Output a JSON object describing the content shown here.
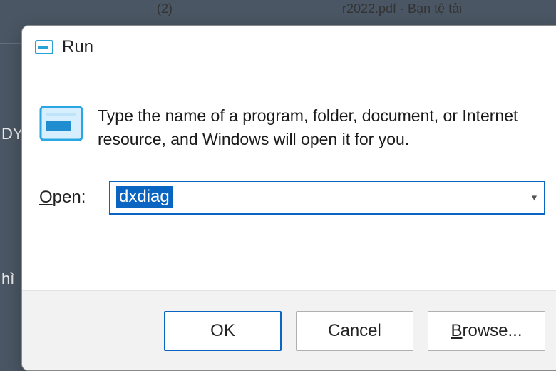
{
  "desktop": {
    "label_dy": "DY",
    "label_hi": "hì",
    "label_top1": "(2)",
    "label_top2": "r2022.pdf · Bạn tệ tải"
  },
  "dialog": {
    "title": "Run",
    "description": "Type the name of a program, folder, document, or Internet resource, and Windows will open it for you.",
    "open_label_prefix": "O",
    "open_label_rest": "pen:",
    "input_value": "dxdiag",
    "buttons": {
      "ok": "OK",
      "cancel": "Cancel",
      "browse_prefix": "B",
      "browse_rest": "rowse..."
    }
  }
}
